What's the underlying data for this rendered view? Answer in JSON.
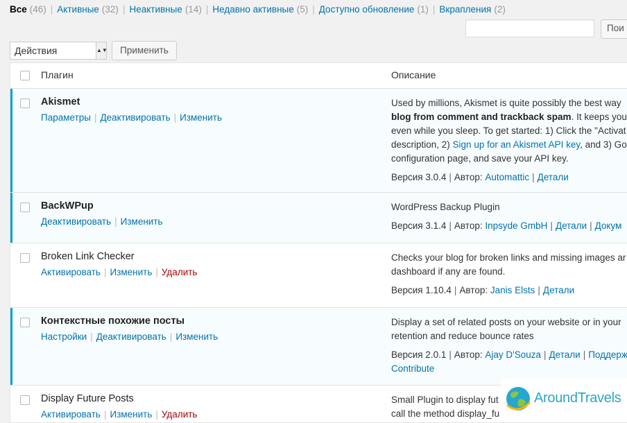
{
  "filters": [
    {
      "label": "Все",
      "count": "(46)"
    },
    {
      "label": "Активные",
      "count": "(32)"
    },
    {
      "label": "Неактивные",
      "count": "(14)"
    },
    {
      "label": "Недавно активные",
      "count": "(5)"
    },
    {
      "label": "Доступно обновление",
      "count": "(1)"
    },
    {
      "label": "Вкрапления",
      "count": "(2)"
    }
  ],
  "filter_sep": "|",
  "search": {
    "button": "Пои"
  },
  "bulk": {
    "selected": "Действия",
    "arrow": "▲▼",
    "apply": "Применить"
  },
  "table": {
    "col_plugin": "Плагин",
    "col_desc": "Описание"
  },
  "sep": "|",
  "plugins": [
    {
      "name": "Akismet",
      "actions": [
        "Параметры",
        "Деактивировать",
        "Изменить"
      ],
      "desc_lines": [
        {
          "pre": "Used by millions, Akismet is quite possibly the best way"
        },
        {
          "bold": "blog from comment and trackback spam",
          "post": ". It keeps your"
        },
        {
          "pre": "even while you sleep. To get started: 1) Click the \"Activat"
        },
        {
          "pre": "description, 2) ",
          "link": "Sign up for an Akismet API key",
          "post": ", and 3) Go"
        },
        {
          "pre": "configuration page, and save your API key."
        }
      ],
      "version": "Версия 3.0.4",
      "author_label": "Автор:",
      "author": "Automattic",
      "links": [
        "Детали"
      ]
    },
    {
      "name": "BackWPup",
      "actions": [
        "Деактивировать",
        "Изменить"
      ],
      "desc_lines": [
        {
          "pre": "WordPress Backup Plugin"
        }
      ],
      "version": "Версия 3.1.4",
      "author_label": "Автор:",
      "author": "Inpsyde GmbH",
      "links": [
        "Детали",
        "Докум"
      ]
    },
    {
      "name": "Broken Link Checker",
      "actions": [
        "Активировать",
        "Изменить",
        "Удалить"
      ],
      "desc_lines": [
        {
          "pre": "Checks your blog for broken links and missing images ar"
        },
        {
          "pre": "dashboard if any are found."
        }
      ],
      "version": "Версия 1.10.4",
      "author_label": "Автор:",
      "author": "Janis Elsts",
      "links": [
        "Детали"
      ]
    },
    {
      "name": "Контекстные похожие посты",
      "actions": [
        "Настройки",
        "Деактивировать",
        "Изменить"
      ],
      "desc_lines": [
        {
          "pre": "Display a set of related posts on your website or in your"
        },
        {
          "pre": "retention and reduce bounce rates"
        }
      ],
      "version": "Версия 2.0.1",
      "author_label": "Автор:",
      "author": "Ajay D'Souza",
      "links": [
        "Детали",
        "Поддерж"
      ],
      "extra_link": "Contribute"
    },
    {
      "name": "Display Future Posts",
      "actions": [
        "Активировать",
        "Изменить",
        "Удалить"
      ],
      "desc_lines": [
        {
          "pre": "Small Plugin to display fut"
        },
        {
          "pre": "call the method display_fu"
        }
      ]
    }
  ],
  "logo": {
    "text": "AroundTravels"
  },
  "colors": {
    "link": "#0073aa",
    "active_bar": "#00a0d2",
    "delete": "#aa0000",
    "active_row": "#f7fcfe"
  }
}
